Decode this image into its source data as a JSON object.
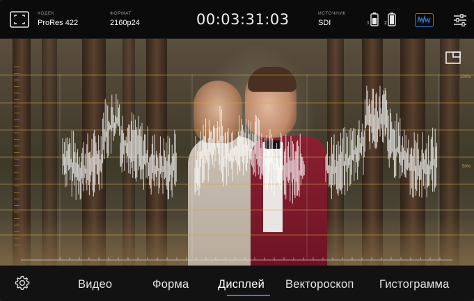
{
  "topbar": {
    "codec_label": "КОДЕК",
    "codec_value": "ProRes 422",
    "format_label": "ФОРМАТ",
    "format_value": "2160p24",
    "timecode": "00:03:31:03",
    "source_label": "ИСТОЧНИК",
    "source_value": "SDI",
    "battery_1": "1",
    "battery_2": "2"
  },
  "scope": {
    "label_100": "100%",
    "label_50": "50%",
    "accent_color": "#d9a43a"
  },
  "menu": {
    "items": [
      "Видео",
      "Форма",
      "Дисплей",
      "Вектороскоп",
      "Гистограмма"
    ],
    "active": "Дисплей"
  },
  "colors": {
    "highlight": "#2f7fd8",
    "graticule": "#d9a43a"
  },
  "icons": [
    "frame-guides-icon",
    "battery-icon",
    "waveform-icon",
    "sliders-icon",
    "pip-icon",
    "gear-icon"
  ]
}
